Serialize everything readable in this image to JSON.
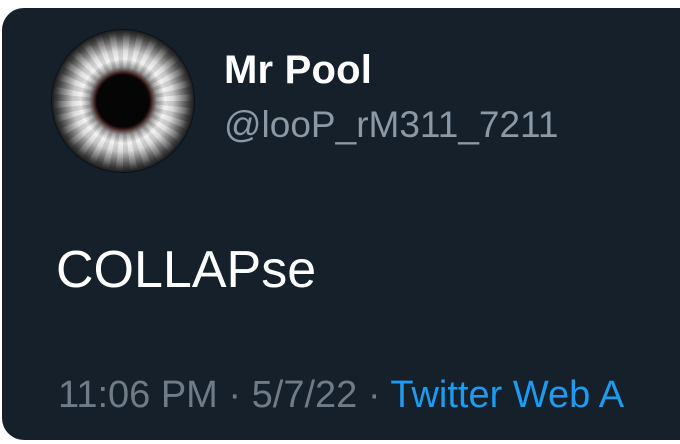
{
  "tweet": {
    "display_name": "Mr Pool",
    "handle": "@looP_rM311_7211",
    "text": "COLLAPse",
    "time": "11:06 PM",
    "date": "5/7/22",
    "separator": "·",
    "source": "Twitter Web A"
  },
  "colors": {
    "card_background": "#15202b",
    "primary_text": "#ffffff",
    "secondary_text": "#8b98a5",
    "link": "#1d9bf0"
  }
}
